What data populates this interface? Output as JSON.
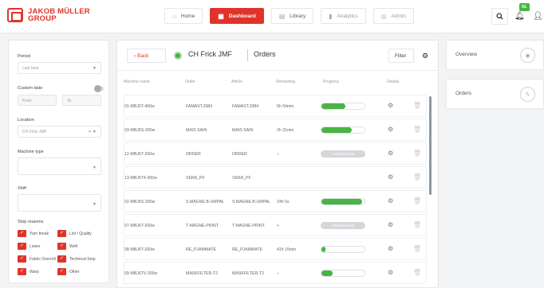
{
  "brand": {
    "name_line1": "JAKOB MÜLLER",
    "name_line2": "GROUP"
  },
  "nav": [
    {
      "label": "Home",
      "icon": "home-icon",
      "glyph": "⌂",
      "active": false
    },
    {
      "label": "Dashboard",
      "icon": "dashboard-icon",
      "glyph": "▦",
      "active": true
    },
    {
      "label": "Library",
      "icon": "library-icon",
      "glyph": "▤",
      "active": false
    },
    {
      "label": "Analytics",
      "icon": "analytics-icon",
      "glyph": "▮",
      "active": false
    },
    {
      "label": "Admin",
      "icon": "admin-icon",
      "glyph": "◎",
      "active": false
    }
  ],
  "notifications": {
    "badge": "NL"
  },
  "colors": {
    "accent": "#e0342b",
    "success": "#49b444"
  },
  "filters": {
    "period_label": "Period",
    "period_value": "Last hour",
    "custom_date_label": "Custom date",
    "from_placeholder": "From",
    "to_placeholder": "To",
    "location_label": "Location",
    "location_value": "CH Frick JMF",
    "machine_type_label": "Machine type",
    "shift_label": "Shift",
    "stop_reasons_label": "Stop reasons",
    "stop_reasons": [
      {
        "label": "Yarn break"
      },
      {
        "label": "Lint / Quality"
      },
      {
        "label": "Lower"
      },
      {
        "label": "Weft"
      },
      {
        "label": "Fabric Overroll"
      },
      {
        "label": "Technical Stop"
      },
      {
        "label": "Warp"
      },
      {
        "label": "Other"
      }
    ]
  },
  "orders_panel": {
    "back_label": "Back",
    "machine": "CH Frick JMF",
    "title": "Orders",
    "filter_label": "Filter",
    "columns": [
      "Machine name",
      "Order",
      "Article",
      "Remaining",
      "Progress",
      "Details"
    ],
    "rows": [
      {
        "machine": "01-MBJ6T-400w",
        "order": "FAMAST.2984",
        "article": "FAMAST.2984",
        "remaining": "5h 54min",
        "progress": 0.55,
        "status": ""
      },
      {
        "machine": "03-MBJ6S-300w",
        "order": "MAIS SAIN",
        "article": "MAIS SAIN",
        "remaining": "2h 31min",
        "progress": 0.7,
        "status": ""
      },
      {
        "machine": "12-MBJ6T-200w",
        "order": "ORDER",
        "article": "ORDER",
        "remaining": "–",
        "progress": null,
        "status": "Undetermined"
      },
      {
        "machine": "13-MBJ6T4-300w",
        "order": "VERA_PF",
        "article": "VERA_PF",
        "remaining": "",
        "progress": null,
        "status": ""
      },
      {
        "machine": "02-MBJ6S-300w",
        "order": "S.MAGNE.B-UMPAL",
        "article": "S.MAGNE.B-UMPAL",
        "remaining": "24h 5s",
        "progress": 0.95,
        "status": ""
      },
      {
        "machine": "07-MBJ6T-200w",
        "order": "T-MAGNE-PRINT",
        "article": "T-MAGNE-PRINT",
        "remaining": "+",
        "progress": null,
        "status": "Undetermined"
      },
      {
        "machine": "08-MBJ6T-200w",
        "order": "RE_PJAMMATE",
        "article": "RE_PJAMMATE",
        "remaining": "41h 15min",
        "progress": 0.1,
        "status": ""
      },
      {
        "machine": "09-MBJ6TV-300w",
        "order": "MASKFILTER-T2",
        "article": "MASKFILTER-T2",
        "remaining": "–",
        "progress": 0.25,
        "status": ""
      }
    ]
  },
  "right_panel": [
    {
      "label": "Overview",
      "icon": "eye-icon",
      "glyph": "◉"
    },
    {
      "label": "Orders",
      "icon": "orders-icon",
      "glyph": "✎"
    }
  ]
}
